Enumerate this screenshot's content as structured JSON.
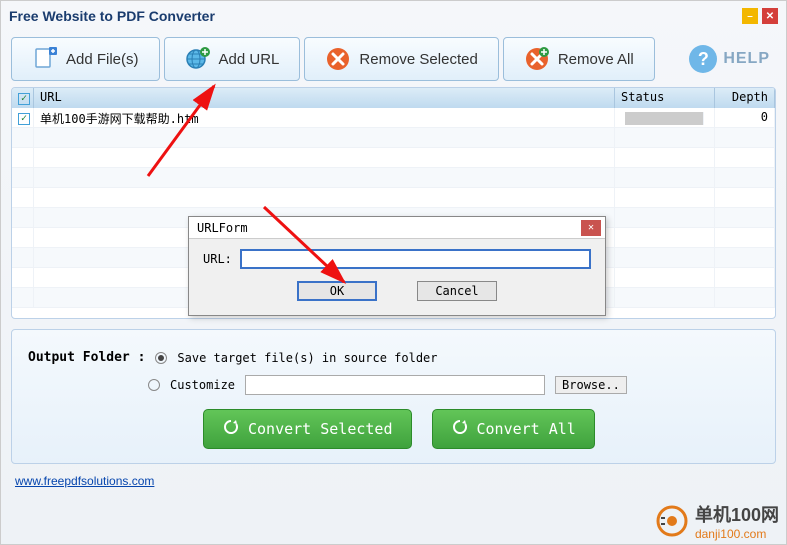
{
  "window": {
    "title": "Free Website to PDF Converter"
  },
  "toolbar": {
    "add_files": "Add File(s)",
    "add_url": "Add URL",
    "remove_selected": "Remove Selected",
    "remove_all": "Remove All",
    "help": "HELP"
  },
  "list": {
    "headers": {
      "url": "URL",
      "status": "Status",
      "depth": "Depth"
    },
    "rows": [
      {
        "checked": true,
        "url": "单机100手游网下载帮助.htm",
        "status": "",
        "depth": "0"
      }
    ]
  },
  "dialog": {
    "title": "URLForm",
    "url_label": "URL:",
    "url_value": "",
    "ok": "OK",
    "cancel": "Cancel"
  },
  "output": {
    "label": "Output Folder :",
    "save_in_source": "Save target file(s) in source folder",
    "customize": "Customize",
    "path": "",
    "browse": "Browse..",
    "convert_selected": "Convert Selected",
    "convert_all": "Convert All"
  },
  "footer": {
    "link": "www.freepdfsolutions.com"
  },
  "watermark": {
    "line1": "单机100网",
    "line2": "danji100.com"
  }
}
